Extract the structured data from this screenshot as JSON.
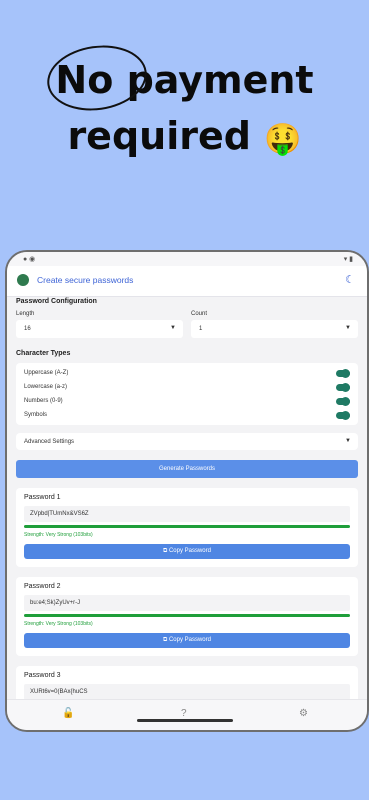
{
  "promo": {
    "line1_circled": "No",
    "line1_rest": "payment",
    "line2": "required",
    "emoji": "🤑"
  },
  "app": {
    "title": "Create secure passwords"
  },
  "config": {
    "title": "Password Configuration",
    "length_label": "Length",
    "length_value": "16",
    "count_label": "Count",
    "count_value": "1"
  },
  "types": {
    "title": "Character Types",
    "items": [
      {
        "label": "Uppercase (A-Z)"
      },
      {
        "label": "Lowercase (a-z)"
      },
      {
        "label": "Numbers (0-9)"
      },
      {
        "label": "Symbols"
      }
    ]
  },
  "advanced_label": "Advanced Settings",
  "generate_label": "Generate Passwords",
  "passwords": [
    {
      "title": "Password 1",
      "value": "ZVpbd|TUmNx&VS6Z",
      "strength": "Strength: Very Strong (103bits)",
      "copy": "Copy Password"
    },
    {
      "title": "Password 2",
      "value": "bu:e4;Sk)ZyUv+r-J",
      "strength": "Strength: Very Strong (103bits)",
      "copy": "Copy Password"
    },
    {
      "title": "Password 3",
      "value": "XURt6v=0(BAx{huCS"
    }
  ],
  "icons": {
    "logo": "turtle-logo-icon",
    "theme": "theme-toggle-icon",
    "nav": [
      "lock-icon",
      "help-icon",
      "settings-icon"
    ]
  }
}
